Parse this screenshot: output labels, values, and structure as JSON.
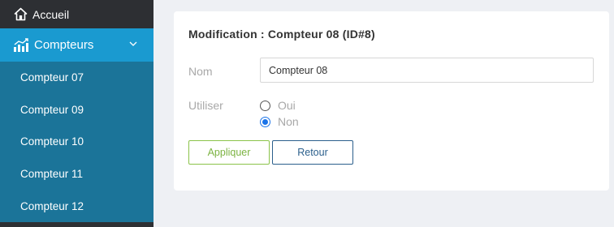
{
  "sidebar": {
    "home": {
      "label": "Accueil",
      "icon": "home-icon"
    },
    "active": {
      "label": "Compteurs",
      "icon": "chart-icon",
      "expanded": true
    },
    "items": [
      {
        "label": "Compteur 07"
      },
      {
        "label": "Compteur 09"
      },
      {
        "label": "Compteur 10"
      },
      {
        "label": "Compteur 11"
      },
      {
        "label": "Compteur 12"
      }
    ]
  },
  "form": {
    "title": "Modification : Compteur 08 (ID#8)",
    "name_label": "Nom",
    "name_value": "Compteur 08",
    "use_label": "Utiliser",
    "options": [
      {
        "label": "Oui",
        "checked": false
      },
      {
        "label": "Non",
        "checked": true
      }
    ],
    "apply_label": "Appliquer",
    "back_label": "Retour"
  },
  "colors": {
    "sidebar_bg": "#2d2f33",
    "active_bg": "#1a9ad0",
    "submenu_bg": "#1b7499",
    "apply": "#7cb342",
    "back": "#2b5f8c",
    "radio_checked": "#1a73e8"
  }
}
